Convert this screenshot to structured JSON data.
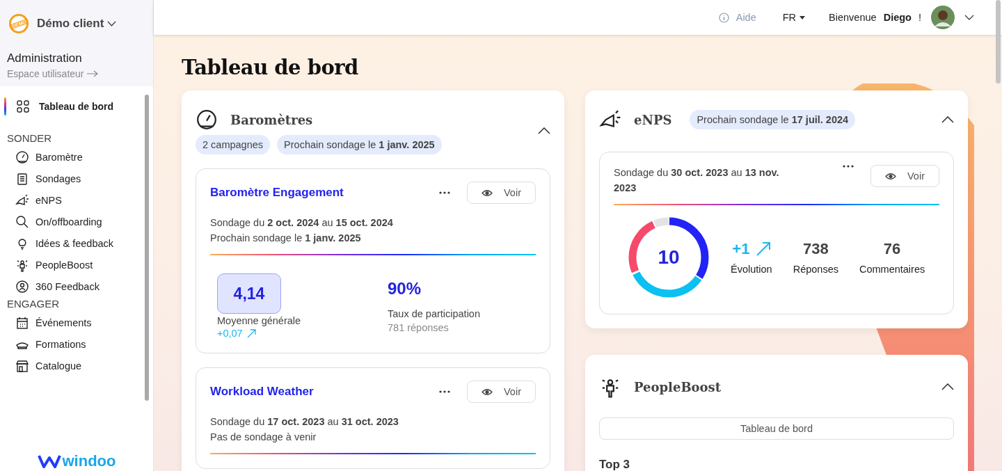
{
  "sidebar": {
    "org": "Démo client",
    "logo_text": "DEMO",
    "section_title": "Administration",
    "switch_link": "Espace utilisateur",
    "items": [
      {
        "label": "Tableau de bord",
        "selected": true
      }
    ],
    "groups": [
      {
        "title": "SONDER",
        "items": [
          {
            "label": "Baromètre",
            "selected": false
          },
          {
            "label": "Sondages",
            "selected": false
          },
          {
            "label": "eNPS",
            "selected": false
          },
          {
            "label": "On/offboarding",
            "selected": false
          },
          {
            "label": "Idées & feedback",
            "selected": false
          },
          {
            "label": "PeopleBoost",
            "selected": false
          },
          {
            "label": "360 Feedback",
            "selected": false
          }
        ]
      },
      {
        "title": "ENGAGER",
        "items": [
          {
            "label": "Événements",
            "selected": false
          },
          {
            "label": "Formations",
            "selected": false
          },
          {
            "label": "Catalogue",
            "selected": false
          }
        ]
      }
    ],
    "brand": "windoo"
  },
  "topbar": {
    "help": "Aide",
    "language": "FR",
    "welcome": "Bienvenue **Diego** !"
  },
  "page_title": "Tableau de bord",
  "barometres": {
    "title": "Baromètres",
    "expanded": true,
    "chips": [
      "2 campagnes",
      "Prochain sondage le **1 janv. 2025**"
    ],
    "campaigns": [
      {
        "title": "Baromètre Engagement",
        "period": "Sondage du **2 oct. 2024** au **15 oct. 2024**",
        "next": "Prochain sondage le **1 janv. 2025**",
        "button": "Voir",
        "score": "4,14",
        "score_label": "Moyenne générale",
        "trend": "+0,07",
        "rate": "90%",
        "rate_label": "Taux de participation",
        "responses": "781 réponses"
      },
      {
        "title": "Workload Weather",
        "period": "Sondage du **17 oct. 2023** au **31 oct. 2023**",
        "next": "Pas de sondage à venir",
        "button": "Voir"
      }
    ]
  },
  "enps": {
    "title": "eNPS",
    "chip": "Prochain sondage le **17 juil. 2024**",
    "expanded": true,
    "survey": {
      "period": "Sondage du **30 oct. 2023** au **13 nov. 2023**",
      "button": "Voir",
      "score": "10",
      "evolution": "+1",
      "evolution_label": "Évolution",
      "responses": "738",
      "responses_label": "Réponses",
      "comments": "76",
      "comments_label": "Commentaires"
    }
  },
  "peopleboost": {
    "title": "PeopleBoost",
    "expanded": true,
    "button": "Tableau de bord",
    "subtitle": "Top 3"
  }
}
